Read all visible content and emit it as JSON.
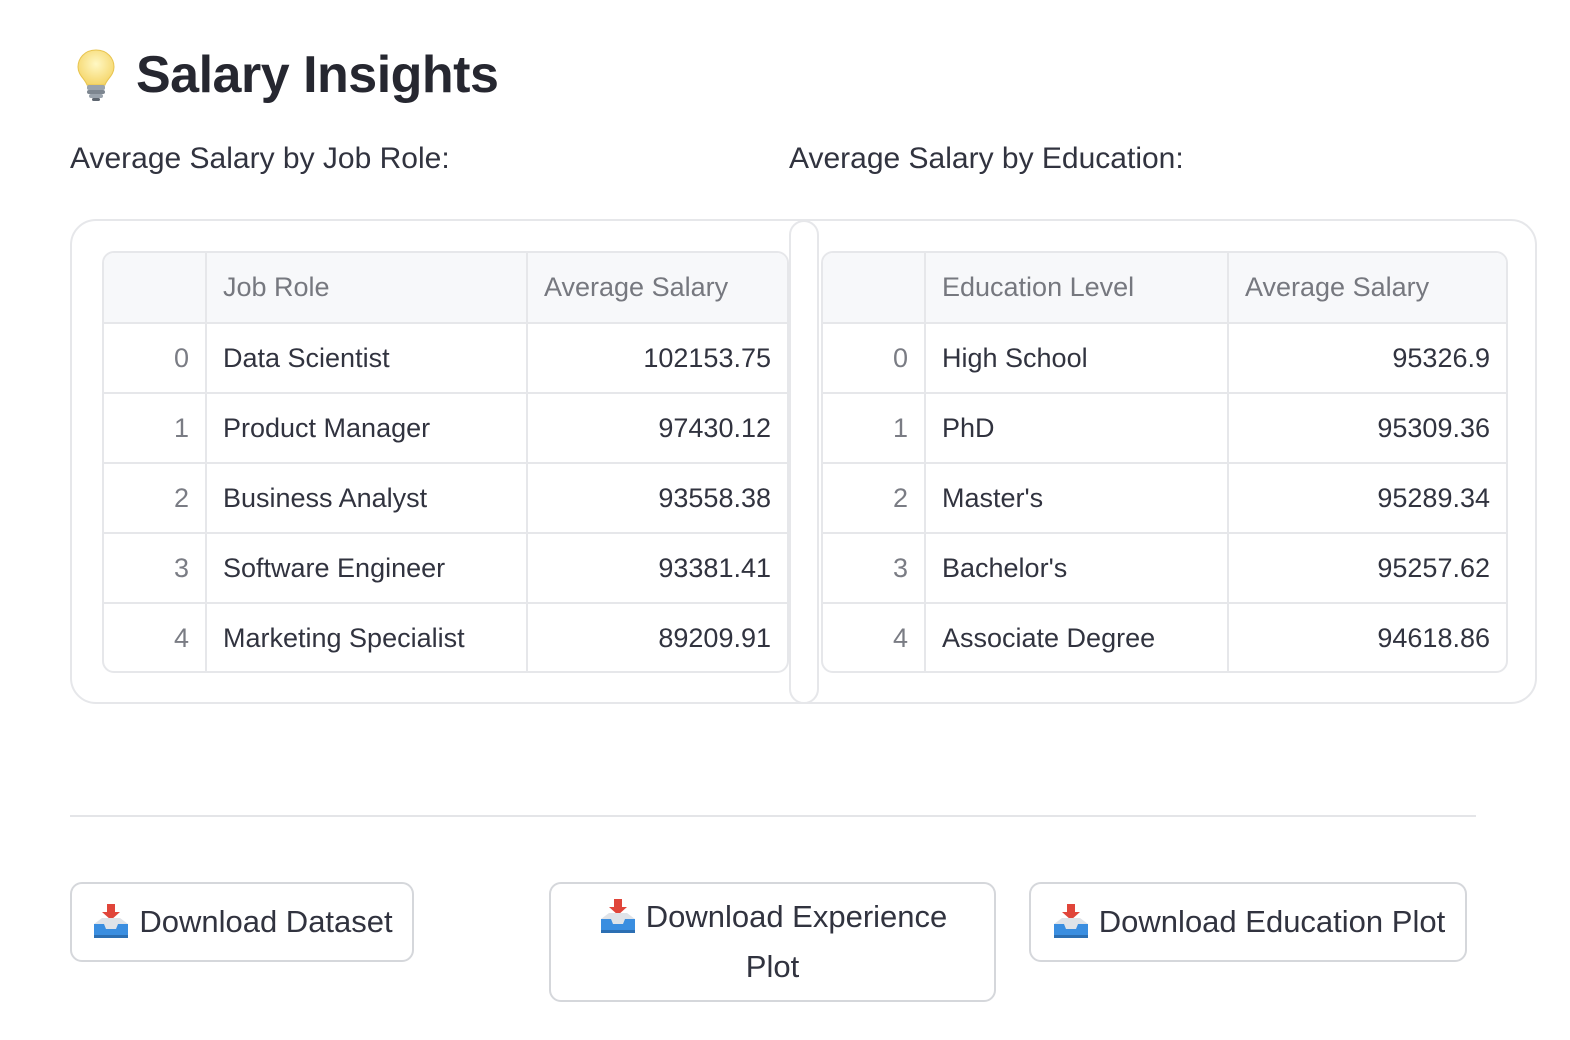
{
  "header": {
    "title": "Salary Insights",
    "icon": "lightbulb-icon"
  },
  "job_section": {
    "heading": "Average Salary by Job Role:",
    "columns": [
      "",
      "Job Role",
      "Average Salary"
    ],
    "rows": [
      {
        "index": "0",
        "label": "Data Scientist",
        "value": "102153.75"
      },
      {
        "index": "1",
        "label": "Product Manager",
        "value": "97430.12"
      },
      {
        "index": "2",
        "label": "Business Analyst",
        "value": "93558.38"
      },
      {
        "index": "3",
        "label": "Software Engineer",
        "value": "93381.41"
      },
      {
        "index": "4",
        "label": "Marketing Specialist",
        "value": "89209.91"
      }
    ]
  },
  "education_section": {
    "heading": "Average Salary by Education:",
    "columns": [
      "",
      "Education Level",
      "Average Salary"
    ],
    "rows": [
      {
        "index": "0",
        "label": "High School",
        "value": "95326.9"
      },
      {
        "index": "1",
        "label": "PhD",
        "value": "95309.36"
      },
      {
        "index": "2",
        "label": "Master's",
        "value": "95289.34"
      },
      {
        "index": "3",
        "label": "Bachelor's",
        "value": "95257.62"
      },
      {
        "index": "4",
        "label": "Associate Degree",
        "value": "94618.86"
      }
    ]
  },
  "buttons": {
    "dataset": "Download Dataset",
    "experience_line1": "Download Experience",
    "experience_line2": "Plot",
    "education": "Download Education Plot",
    "icon": "inbox-tray-icon"
  },
  "colors": {
    "text": "#31333f",
    "border": "#e6e7ea",
    "header_bg": "#f7f8fa"
  }
}
